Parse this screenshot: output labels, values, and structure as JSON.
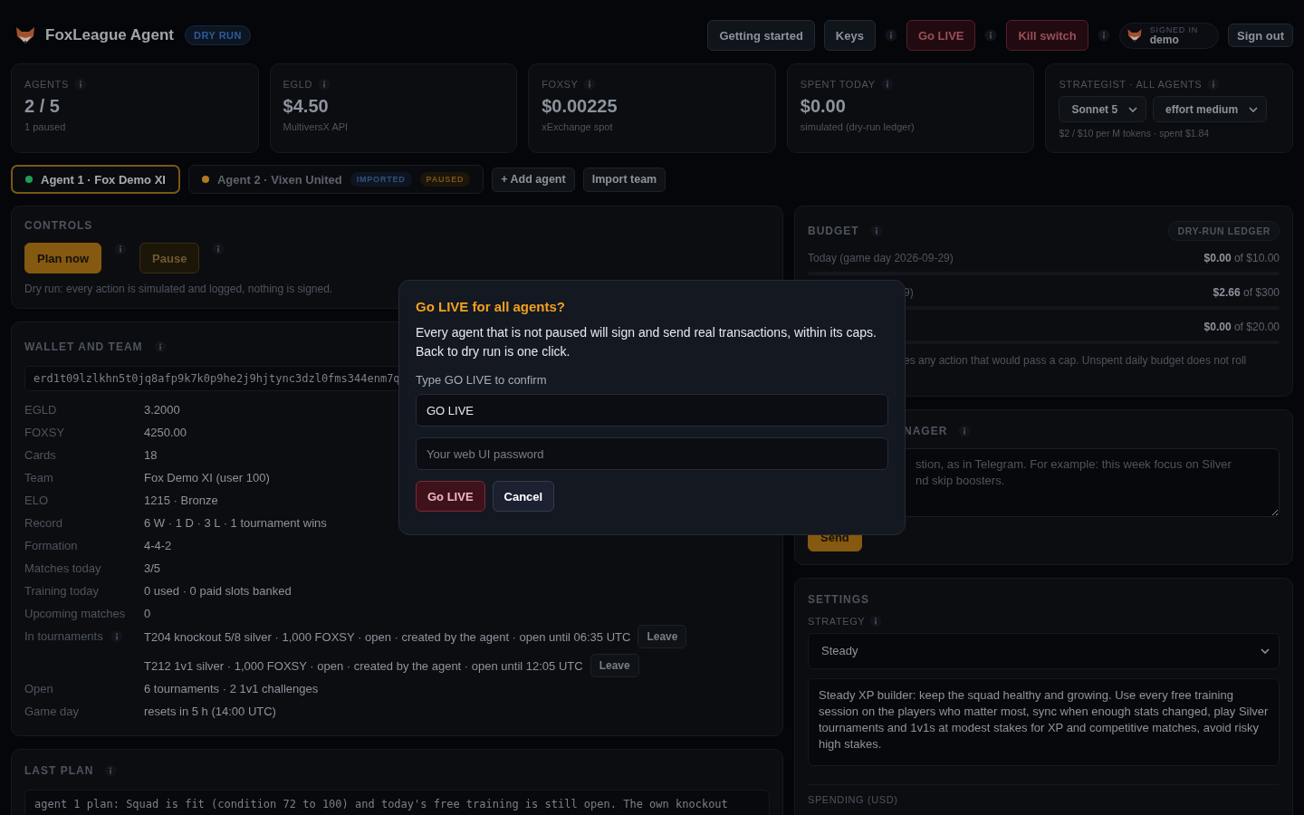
{
  "header": {
    "title": "FoxLeague Agent",
    "mode_badge": "DRY RUN",
    "buttons": [
      {
        "label": "Getting started",
        "kind": "plain",
        "info": false
      },
      {
        "label": "Keys",
        "kind": "plain",
        "info": true
      },
      {
        "label": "Go LIVE",
        "kind": "danger",
        "info": true
      },
      {
        "label": "Kill switch",
        "kind": "danger",
        "info": true
      }
    ],
    "user": {
      "status": "SIGNED IN",
      "name": "demo"
    },
    "sign_out": "Sign out"
  },
  "stats": [
    {
      "label": "AGENTS",
      "value": "2 / 5",
      "note": "1 paused"
    },
    {
      "label": "EGLD",
      "value": "$4.50",
      "note": "MultiversX API"
    },
    {
      "label": "FOXSY",
      "value": "$0.00225",
      "note": "xExchange spot"
    },
    {
      "label": "SPENT TODAY",
      "value": "$0.00",
      "note": "simulated (dry-run ledger)"
    }
  ],
  "strategist": {
    "label": "STRATEGIST · ALL AGENTS",
    "model": "Sonnet 5",
    "effort": "effort medium",
    "note": "$2 / $10 per M tokens · spent $1.84"
  },
  "agents": [
    {
      "label": "Agent 1 · Fox Demo XI",
      "color": "#1f9d55",
      "selected": true
    },
    {
      "label": "Agent 2 · Vixen United",
      "color": "#b07a20",
      "selected": false,
      "badges": [
        {
          "text": "IMPORTED",
          "kind": "info"
        },
        {
          "text": "PAUSED",
          "kind": "warn"
        }
      ]
    }
  ],
  "agent_actions": [
    "+ Add agent",
    "Import team"
  ],
  "controls": {
    "title": "CONTROLS",
    "buttons": [
      {
        "label": "Plan now",
        "kind": "primary"
      },
      {
        "label": "Pause",
        "kind": "secondary"
      }
    ],
    "note": "Dry run: every action is simulated and logged, nothing is signed."
  },
  "wallet": {
    "title": "WALLET AND TEAM",
    "address": "erd1t09lzlkhn5t0jq8afp9k7k0p9he2j9hjtync3dzl0fms344enm7q",
    "rows": [
      {
        "label": "EGLD",
        "kind": "text",
        "info": false,
        "value": "3.2000"
      },
      {
        "label": "FOXSY",
        "kind": "text",
        "info": false,
        "value": "4250.00"
      },
      {
        "label": "Cards",
        "kind": "text",
        "info": false,
        "value": "18"
      },
      {
        "label": "Team",
        "kind": "text",
        "info": false,
        "value": "Fox Demo XI (user 100)"
      },
      {
        "label": "ELO",
        "kind": "text",
        "info": false,
        "value": "1215 · Bronze"
      },
      {
        "label": "Record",
        "kind": "text",
        "info": false,
        "value": "6 W · 1 D · 3 L · 1 tournament wins"
      },
      {
        "label": "Formation",
        "kind": "text",
        "info": false,
        "value": "4-4-2"
      },
      {
        "label": "Matches today",
        "kind": "text",
        "info": false,
        "value": "3/5"
      },
      {
        "label": "Training today",
        "kind": "text",
        "info": false,
        "value": "0 used · 0 paid slots banked"
      },
      {
        "label": "Upcoming matches",
        "kind": "text",
        "info": false,
        "value": "0"
      },
      {
        "label": "In tournaments",
        "kind": "list",
        "info": true,
        "entries": [
          {
            "text": "T204 knockout 5/8 silver · 1,000 FOXSY · open · created by the agent · open until 06:35 UTC",
            "action": "Leave"
          },
          {
            "text": "T212 1v1 silver · 1,000 FOXSY · open · created by the agent · open until 12:05 UTC",
            "action": "Leave"
          }
        ]
      },
      {
        "label": "Open",
        "kind": "text",
        "info": false,
        "value": "6 tournaments · 2 1v1 challenges"
      },
      {
        "label": "Game day",
        "kind": "text",
        "info": false,
        "value": "resets in 5 h (14:00 UTC)"
      }
    ]
  },
  "last_plan": {
    "title": "LAST PLAN",
    "text": "agent 1 plan: Squad is fit (condition 72 to 100) and today's free training is still open. The own knockout"
  },
  "budget": {
    "title": "BUDGET",
    "badge": "DRY-RUN LEDGER",
    "rows": [
      {
        "label": "Today (game day 2026-09-29)",
        "amount": "**$0.00** of $10.00",
        "level": 0
      },
      {
        "label": "9)",
        "amount": "**$2.66** of $300",
        "level": 0.009
      },
      {
        "amount": "**$0.00** of $20.00",
        "level": 0
      }
    ],
    "note": "es any action that would pass a cap. Unspent daily budget does not roll"
  },
  "manager": {
    "title": "NAGER",
    "placeholder": "stion, as in Telegram. For example: this week focus on Silver\nnd skip boosters.",
    "button": "Send"
  },
  "settings": {
    "title": "SETTINGS",
    "strategy_label": "STRATEGY",
    "strategy": "Steady",
    "description": "Steady XP builder: keep the squad healthy and growing. Use every free training session on the players who matter most, sync when enough stats changed, play Silver tournaments and 1v1s at modest stakes for XP and competitive matches, avoid risky high stakes.",
    "spending_label": "SPENDING (USD)"
  },
  "modal": {
    "title": "Go LIVE for all agents?",
    "text": "Every agent that is not paused will sign and send real transactions, within its caps. Back to dry run is one click.",
    "field_label": "Type GO LIVE to confirm",
    "value": "GO LIVE",
    "password_placeholder": "Your web UI password",
    "buttons": [
      {
        "label": "Go LIVE",
        "kind": "danger"
      },
      {
        "label": "Cancel",
        "kind": "plain"
      }
    ]
  }
}
